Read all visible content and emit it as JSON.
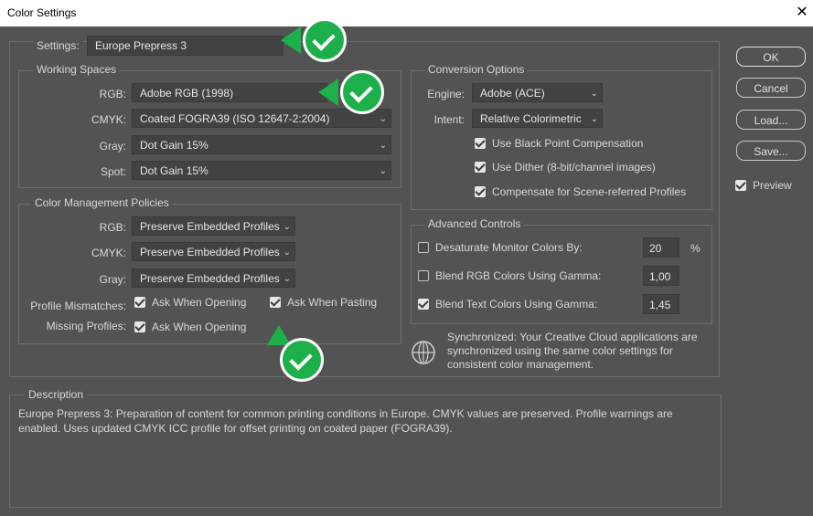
{
  "window": {
    "title": "Color Settings",
    "close_symbol": "✕"
  },
  "settings": {
    "label": "Settings:",
    "value": "Europe Prepress 3"
  },
  "working_spaces": {
    "legend": "Working Spaces",
    "rows": [
      {
        "label": "RGB:",
        "value": "Adobe RGB (1998)"
      },
      {
        "label": "CMYK:",
        "value": "Coated FOGRA39 (ISO 12647-2:2004)"
      },
      {
        "label": "Gray:",
        "value": "Dot Gain 15%"
      },
      {
        "label": "Spot:",
        "value": "Dot Gain 15%"
      }
    ]
  },
  "policies": {
    "legend": "Color Management Policies",
    "rows": [
      {
        "label": "RGB:",
        "value": "Preserve Embedded Profiles"
      },
      {
        "label": "CMYK:",
        "value": "Preserve Embedded Profiles"
      },
      {
        "label": "Gray:",
        "value": "Preserve Embedded Profiles"
      }
    ],
    "mismatch_label": "Profile Mismatches:",
    "mismatch_opening": "Ask When Opening",
    "mismatch_pasting": "Ask When Pasting",
    "missing_label": "Missing Profiles:",
    "missing_opening": "Ask When Opening"
  },
  "conversion": {
    "legend": "Conversion Options",
    "engine_label": "Engine:",
    "engine_value": "Adobe (ACE)",
    "intent_label": "Intent:",
    "intent_value": "Relative Colorimetric",
    "checks": [
      {
        "label": "Use Black Point Compensation",
        "checked": true
      },
      {
        "label": "Use Dither (8-bit/channel images)",
        "checked": true
      },
      {
        "label": "Compensate for Scene-referred Profiles",
        "checked": true
      }
    ]
  },
  "advanced": {
    "legend": "Advanced Controls",
    "rows": [
      {
        "label": "Desaturate Monitor Colors By:",
        "value": "20",
        "unit": "%",
        "checked": false
      },
      {
        "label": "Blend RGB Colors Using Gamma:",
        "value": "1,00",
        "unit": "",
        "checked": false
      },
      {
        "label": "Blend Text Colors Using Gamma:",
        "value": "1,45",
        "unit": "",
        "checked": true
      }
    ]
  },
  "sync": {
    "icon": "globe-icon",
    "line1": "Synchronized: Your Creative Cloud applications are",
    "line2": "synchronized using the same color settings for",
    "line3": "consistent color management."
  },
  "description": {
    "legend": "Description",
    "line1": "Europe Prepress 3:  Preparation of content for common printing conditions in Europe. CMYK values are preserved. Profile warnings are",
    "line2": "enabled. Uses updated CMYK ICC profile for offset printing on coated paper (FOGRA39)."
  },
  "buttons": {
    "ok": "OK",
    "cancel": "Cancel",
    "load": "Load...",
    "save": "Save...",
    "preview": "Preview",
    "preview_checked": true
  },
  "colors": {
    "badge_green": "#1db04a",
    "panel_bg": "#535353",
    "field_bg": "#424242"
  }
}
